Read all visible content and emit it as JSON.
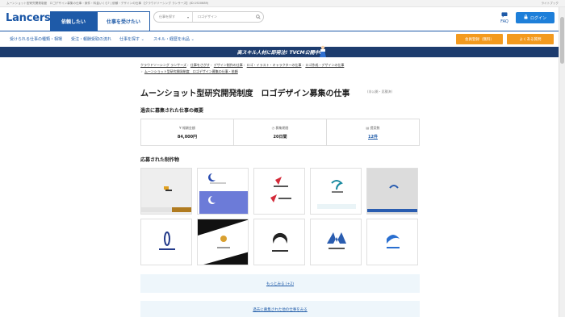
{
  "browser": {
    "page_title": "ムーンショット型研究開発制度　ロゴデザイン募集の仕事・案件・料金いくら? | 依頼・デザインの仕事 【クラウドソーシング ランサーズ】(ID:1920689)",
    "right_text": "ライトブック"
  },
  "header": {
    "logo": "Lancers",
    "tab_order": "依頼したい",
    "tab_work": "仕事を受けたい",
    "search_select": "仕事を探す",
    "search_placeholder": "ロゴデザイン",
    "faq": "FAQ",
    "login": "ログイン"
  },
  "nav": {
    "items": [
      "受けられる仕事の種類・相場",
      "受注・報酬受取の流れ",
      "仕事を探す",
      "スキル・経歴を出品"
    ],
    "btn_register": "会員登録（無料）",
    "btn_ask": "よくある質問"
  },
  "banner": {
    "text": "高スキル人材に即発注! TVCM公開中!"
  },
  "breadcrumb": {
    "line1": [
      "クラウドソーシング ランサーズ",
      "仕事をさがす",
      "デザイン制作の仕事",
      "ロゴ・イラスト・キャラクターの仕事",
      "ロゴ作成・デザインの仕事"
    ],
    "line2": "ムーンショット型研究開発制度　ロゴデザイン募集の仕事・依頼"
  },
  "title": "ムーンショット型研究開発制度　ロゴデザイン募集の仕事",
  "title_meta": "(非公開・見積済)",
  "summary": {
    "heading": "過去に募集された仕事の概要",
    "items": [
      {
        "label": "報酬金額",
        "value": "84,000円"
      },
      {
        "label": "募集期間",
        "value": "20日間"
      },
      {
        "label": "提案数",
        "value": "12件"
      }
    ]
  },
  "works": {
    "heading": "応募された制作物",
    "thumbs": [
      "work-1",
      "work-2",
      "work-3",
      "work-4",
      "work-5",
      "work-6",
      "work-7",
      "work-8",
      "work-9",
      "work-10"
    ],
    "more": "もっとみる (+2)"
  },
  "past_link": "過去に募集された他の仕事をみる",
  "colors": {
    "brand": "#1e5aa8",
    "accent": "#f39a1e",
    "banner": "#1d3c6e",
    "panel": "#eef6fb"
  }
}
